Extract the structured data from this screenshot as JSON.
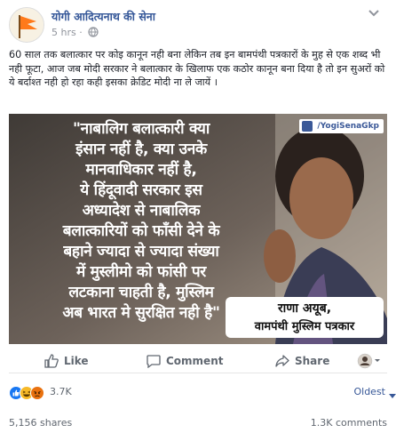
{
  "post": {
    "page_name": "योगी आदित्यनाथ की सेना",
    "time": "5 hrs ·",
    "text": "60 साल तक बलात्कार पर कोइ कानून नही बना लेकिन तब इन बामपंथी पत्रकारों के मुह से एक शब्द भी नही फूटा, आज जब मोदी सरकार ने बलात्कार के खिलाफ एक कठोर कानून बना दिया है तो इन सुअरों को ये बर्दाश्त नही हो रहा कही इसका क्रेडिट मोदी ना ले जायें ।"
  },
  "image": {
    "quote_lines": [
      "\"नाबालिग बलात्कारी क्या",
      "इंसान नहीं है, क्या उनके",
      "मानवाधिकार नहीं है,",
      "ये हिंदूवादी सरकार इस",
      "अध्यादेश से नाबालिक",
      "बलात्कारियों को फाँसी देने के",
      "बहाने ज्यादा से ज्यादा संख्या",
      "में मुस्लीमो को फांसी पर",
      "लटकाना चाहती है, मुस्लिम",
      "अब भारत मे सुरक्षित नही है\""
    ],
    "handle": "/YogiSenaGkp",
    "caption_name": "राणा अयूब,",
    "caption_desc": "वामपंथी मुस्लिम पत्रकार"
  },
  "actions": {
    "like": "Like",
    "comment": "Comment",
    "share": "Share"
  },
  "reactions": {
    "count": "3.7K",
    "sort": "Oldest"
  },
  "stats": {
    "shares": "5,156 shares",
    "comments": "1.3K comments"
  },
  "colors": {
    "link_blue": "#365899",
    "like_blue": "#1877f2",
    "haha_yellow": "#f7b928",
    "angry_orange": "#e9710f"
  }
}
